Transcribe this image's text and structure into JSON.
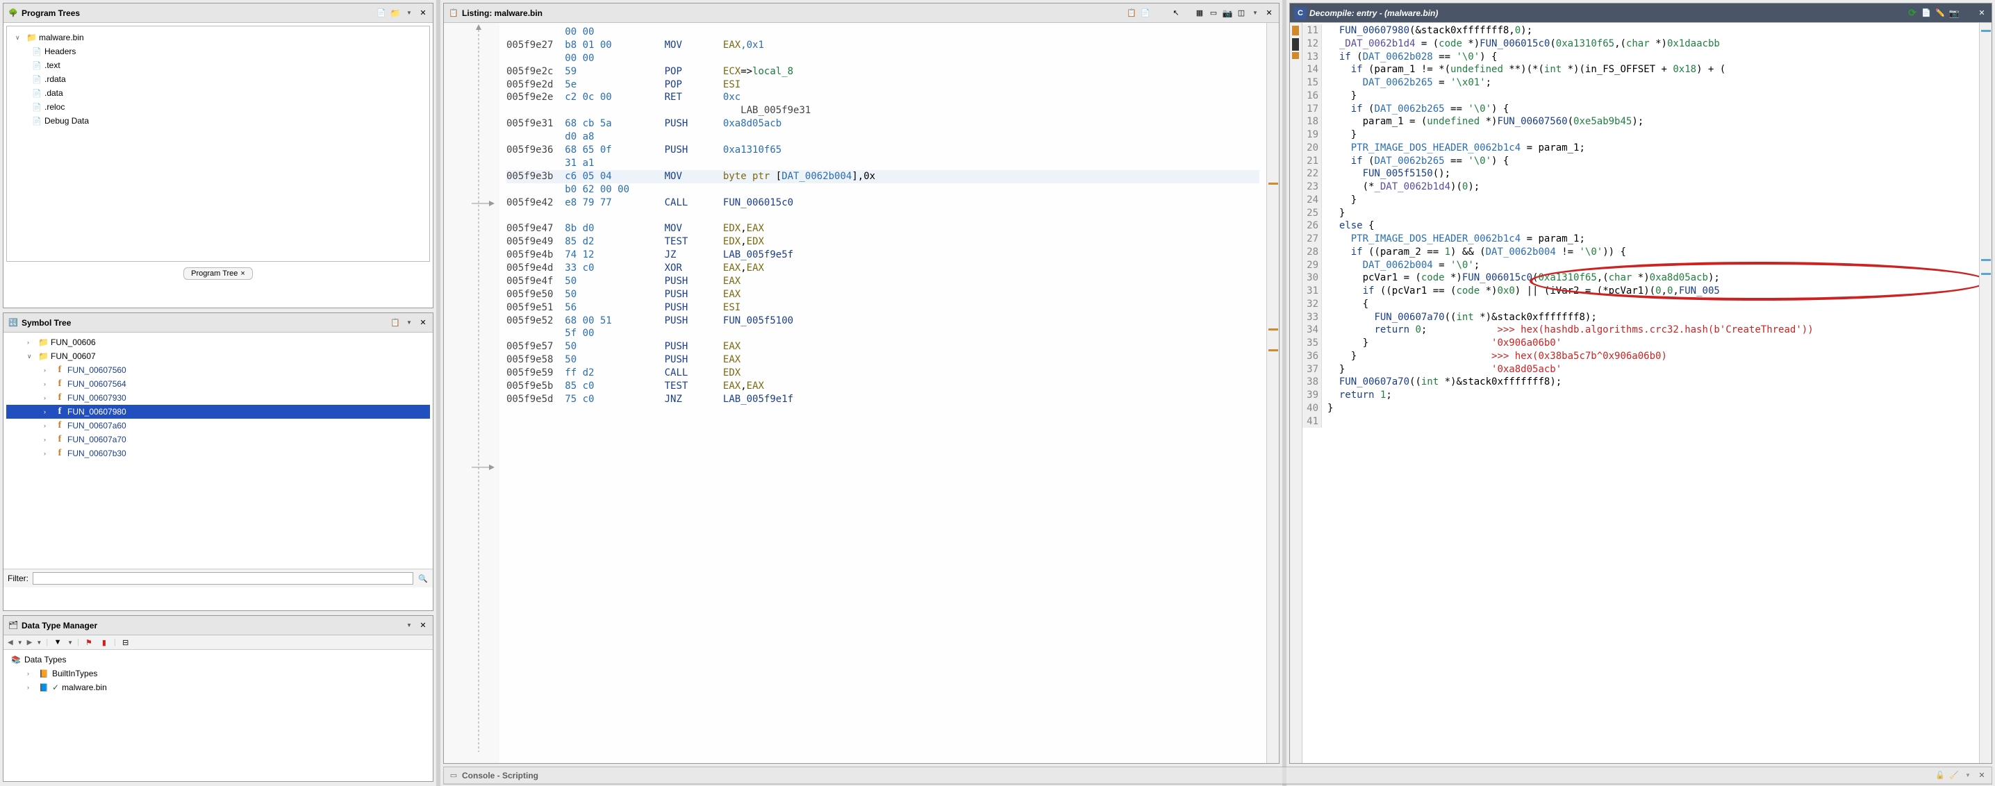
{
  "programTrees": {
    "title": "Program Trees",
    "root": "malware.bin",
    "children": [
      "Headers",
      ".text",
      ".rdata",
      ".data",
      ".reloc",
      "Debug Data"
    ],
    "tab": "Program Tree"
  },
  "symbolTree": {
    "title": "Symbol Tree",
    "folders": [
      "FUN_00606",
      "FUN_00607"
    ],
    "functions": [
      "FUN_00607560",
      "FUN_00607564",
      "FUN_00607930",
      "FUN_00607980",
      "FUN_00607a60",
      "FUN_00607a70",
      "FUN_00607b30"
    ],
    "selected": "FUN_00607980",
    "filterLabel": "Filter:"
  },
  "dataTypeMgr": {
    "title": "Data Type Manager",
    "root": "Data Types",
    "items": [
      "BuiltInTypes",
      "malware.bin"
    ]
  },
  "listing": {
    "title": "Listing:  malware.bin",
    "rows": [
      {
        "addr": "",
        "bytes": "00 00",
        "label": ""
      },
      {
        "addr": "005f9e27",
        "bytes": "b8 01 00",
        "mnem": "MOV",
        "ops": [
          {
            "t": "EAX",
            "c": "reg"
          },
          {
            "t": ",0x1",
            "c": "num"
          }
        ]
      },
      {
        "addr": "",
        "bytes": "00 00"
      },
      {
        "addr": "005f9e2c",
        "bytes": "59",
        "mnem": "POP",
        "ops": [
          {
            "t": "ECX",
            "c": "reg"
          },
          {
            "t": "=>",
            "c": "plain"
          },
          {
            "t": "local_8",
            "c": "green"
          }
        ]
      },
      {
        "addr": "005f9e2d",
        "bytes": "5e",
        "mnem": "POP",
        "ops": [
          {
            "t": "ESI",
            "c": "reg"
          }
        ]
      },
      {
        "addr": "005f9e2e",
        "bytes": "c2 0c 00",
        "mnem": "RET",
        "ops": [
          {
            "t": "0xc",
            "c": "num"
          }
        ]
      },
      {
        "addr": "",
        "bytes": "",
        "label": "LAB_005f9e31"
      },
      {
        "addr": "005f9e31",
        "bytes": "68 cb 5a",
        "mnem": "PUSH",
        "ops": [
          {
            "t": "0xa8d05acb",
            "c": "num"
          }
        ]
      },
      {
        "addr": "",
        "bytes": "d0 a8"
      },
      {
        "addr": "005f9e36",
        "bytes": "68 65 0f",
        "mnem": "PUSH",
        "ops": [
          {
            "t": "0xa1310f65",
            "c": "num"
          }
        ]
      },
      {
        "addr": "",
        "bytes": "31 a1"
      },
      {
        "addr": "005f9e3b",
        "bytes": "c6 05 04",
        "mnem": "MOV",
        "ops": [
          {
            "t": "byte ptr ",
            "c": "reg"
          },
          {
            "t": "[",
            "c": "plain"
          },
          {
            "t": "DAT_0062b004",
            "c": "sym"
          },
          {
            "t": "],0x",
            "c": "plain"
          }
        ],
        "hl": true
      },
      {
        "addr": "",
        "bytes": "b0 62 00 00"
      },
      {
        "addr": "005f9e42",
        "bytes": "e8 79 77",
        "mnem": "CALL",
        "ops": [
          {
            "t": "FUN_006015c0",
            "c": "call"
          }
        ]
      },
      {
        "addr": "",
        "bytes": ""
      },
      {
        "addr": "005f9e47",
        "bytes": "8b d0",
        "mnem": "MOV",
        "ops": [
          {
            "t": "EDX",
            "c": "reg"
          },
          {
            "t": ",",
            "c": "plain"
          },
          {
            "t": "EAX",
            "c": "reg"
          }
        ]
      },
      {
        "addr": "005f9e49",
        "bytes": "85 d2",
        "mnem": "TEST",
        "ops": [
          {
            "t": "EDX",
            "c": "reg"
          },
          {
            "t": ",",
            "c": "plain"
          },
          {
            "t": "EDX",
            "c": "reg"
          }
        ]
      },
      {
        "addr": "005f9e4b",
        "bytes": "74 12",
        "mnem": "JZ",
        "ops": [
          {
            "t": "LAB_005f9e5f",
            "c": "call"
          }
        ]
      },
      {
        "addr": "005f9e4d",
        "bytes": "33 c0",
        "mnem": "XOR",
        "ops": [
          {
            "t": "EAX",
            "c": "reg"
          },
          {
            "t": ",",
            "c": "plain"
          },
          {
            "t": "EAX",
            "c": "reg"
          }
        ]
      },
      {
        "addr": "005f9e4f",
        "bytes": "50",
        "mnem": "PUSH",
        "ops": [
          {
            "t": "EAX",
            "c": "reg"
          }
        ]
      },
      {
        "addr": "005f9e50",
        "bytes": "50",
        "mnem": "PUSH",
        "ops": [
          {
            "t": "EAX",
            "c": "reg"
          }
        ]
      },
      {
        "addr": "005f9e51",
        "bytes": "56",
        "mnem": "PUSH",
        "ops": [
          {
            "t": "ESI",
            "c": "reg"
          }
        ]
      },
      {
        "addr": "005f9e52",
        "bytes": "68 00 51",
        "mnem": "PUSH",
        "ops": [
          {
            "t": "FUN_005f5100",
            "c": "call"
          }
        ]
      },
      {
        "addr": "",
        "bytes": "5f 00"
      },
      {
        "addr": "005f9e57",
        "bytes": "50",
        "mnem": "PUSH",
        "ops": [
          {
            "t": "EAX",
            "c": "reg"
          }
        ]
      },
      {
        "addr": "005f9e58",
        "bytes": "50",
        "mnem": "PUSH",
        "ops": [
          {
            "t": "EAX",
            "c": "reg"
          }
        ]
      },
      {
        "addr": "005f9e59",
        "bytes": "ff d2",
        "mnem": "CALL",
        "ops": [
          {
            "t": "EDX",
            "c": "reg"
          }
        ]
      },
      {
        "addr": "005f9e5b",
        "bytes": "85 c0",
        "mnem": "TEST",
        "ops": [
          {
            "t": "EAX",
            "c": "reg"
          },
          {
            "t": ",",
            "c": "plain"
          },
          {
            "t": "EAX",
            "c": "reg"
          }
        ]
      },
      {
        "addr": "005f9e5d",
        "bytes": "75 c0",
        "mnem": "JNZ",
        "ops": [
          {
            "t": "LAB_005f9e1f",
            "c": "call"
          }
        ]
      }
    ]
  },
  "decompile": {
    "title": "Decompile: entry -  (malware.bin)",
    "lines": [
      {
        "n": 11,
        "html": "  <span class='fn'>FUN_00607980</span>(&amp;stack0xfffffff8,<span class='num'>0</span>);"
      },
      {
        "n": 12,
        "html": "  <span class='glob'>_DAT_0062b1d4</span> = (<span class='type'>code</span> *)<span class='fn'>FUN_006015c0</span>(<span class='num'>0xa1310f65</span>,(<span class='type'>char</span> *)<span class='num'>0x1daacbb</span>"
      },
      {
        "n": 13,
        "html": "  <span class='kw'>if</span> (<span class='glob2'>DAT_0062b028</span> == <span class='num'>'\\0'</span>) {"
      },
      {
        "n": 14,
        "html": "    <span class='kw'>if</span> (param_1 != *(<span class='type'>undefined</span> **)(*(<span class='type'>int</span> *)(in_FS_OFFSET + <span class='num'>0x18</span>) + ("
      },
      {
        "n": 15,
        "html": "      <span class='glob2'>DAT_0062b265</span> = <span class='num'>'\\x01'</span>;"
      },
      {
        "n": 16,
        "html": "    }"
      },
      {
        "n": 17,
        "html": "    <span class='kw'>if</span> (<span class='glob2'>DAT_0062b265</span> == <span class='num'>'\\0'</span>) {"
      },
      {
        "n": 18,
        "html": "      param_1 = (<span class='type'>undefined</span> *)<span class='fn'>FUN_00607560</span>(<span class='num'>0xe5ab9b45</span>);"
      },
      {
        "n": 19,
        "html": "    }"
      },
      {
        "n": 20,
        "html": "    <span class='glob2'>PTR_IMAGE_DOS_HEADER_0062b1c4</span> = param_1;"
      },
      {
        "n": 21,
        "html": "    <span class='kw'>if</span> (<span class='glob2'>DAT_0062b265</span> == <span class='num'>'\\0'</span>) {"
      },
      {
        "n": 22,
        "html": "      <span class='fn'>FUN_005f5150</span>();"
      },
      {
        "n": 23,
        "html": "      (*<span class='glob'>_DAT_0062b1d4</span>)(<span class='num'>0</span>);"
      },
      {
        "n": 24,
        "html": "    }"
      },
      {
        "n": 25,
        "html": "  }"
      },
      {
        "n": 26,
        "html": "  <span class='kw'>else</span> {"
      },
      {
        "n": 27,
        "html": "    <span class='glob2'>PTR_IMAGE_DOS_HEADER_0062b1c4</span> = param_1;"
      },
      {
        "n": 28,
        "html": "    <span class='kw'>if</span> ((param_2 == <span class='num'>1</span>) &amp;&amp; (<span class='glob2'>DAT_0062b004</span> != <span class='num'>'\\0'</span>)) {"
      },
      {
        "n": 29,
        "html": "      <span class='glob2'>DAT_0062b004</span> = <span class='num'>'\\0'</span>;"
      },
      {
        "n": 30,
        "html": "      pcVar1 = (<span class='type'>code</span> *)<span class='fn'>FUN_006015c0</span>(<span class='num'>0xa1310f65</span>,(<span class='type'>char</span> *)<span class='num'>0xa8d05acb</span>);"
      },
      {
        "n": 31,
        "html": "      <span class='kw'>if</span> ((pcVar1 == (<span class='type'>code</span> *)<span class='num'>0x0</span>) || (iVar2 = (*pcVar1)(<span class='num'>0</span>,<span class='num'>0</span>,<span class='fn'>FUN_005</span>"
      },
      {
        "n": 32,
        "html": "      {"
      },
      {
        "n": 33,
        "html": "        <span class='fn'>FUN_00607a70</span>((<span class='type'>int</span> *)&amp;stack0xfffffff8);"
      },
      {
        "n": 34,
        "html": "        <span class='kw'>return</span> <span class='num'>0</span>;            <span class='comment-red'>&gt;&gt;&gt; hex(hashdb.algorithms.crc32.hash(b'CreateThread'))</span>"
      },
      {
        "n": 35,
        "html": "      }                     <span class='comment-red'>'0x906a06b0'</span>"
      },
      {
        "n": 36,
        "html": "    }                       <span class='comment-red'>&gt;&gt;&gt; hex(0x38ba5c7b^0x906a06b0)</span>"
      },
      {
        "n": 37,
        "html": "  }                         <span class='comment-red'>'0xa8d05acb'</span>"
      },
      {
        "n": 38,
        "html": "  <span class='fn'>FUN_00607a70</span>((<span class='type'>int</span> *)&amp;stack0xfffffff8);"
      },
      {
        "n": 39,
        "html": "  <span class='kw'>return</span> <span class='num'>1</span>;"
      },
      {
        "n": 40,
        "html": "}"
      },
      {
        "n": 41,
        "html": ""
      }
    ]
  },
  "console": {
    "title": "Console - Scripting"
  }
}
